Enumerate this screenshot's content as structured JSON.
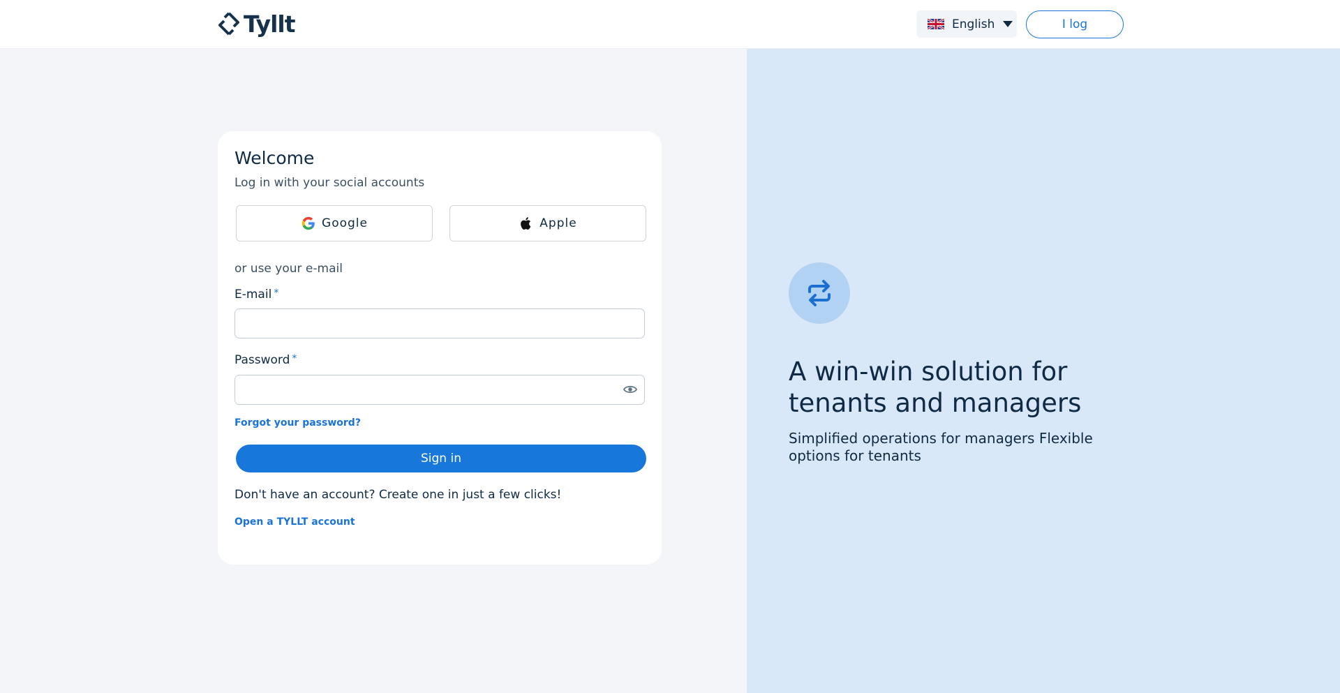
{
  "header": {
    "logo_text": "Tyllt",
    "language": {
      "selected": "English",
      "flag": "uk-flag-icon"
    },
    "login_label": "I log"
  },
  "login": {
    "title": "Welcome",
    "subtitle": "Log in with your social accounts",
    "google_label": "Google",
    "apple_label": "Apple",
    "or_email": "or use your e-mail",
    "email_label": "E-mail",
    "email_value": "",
    "password_label": "Password",
    "password_value": "",
    "required_mark": "*",
    "forgot_label": "Forgot your password?",
    "signin_label": "Sign in",
    "no_account_text": "Don't have an account? Create one in just a few clicks!",
    "open_account_label": "Open a TYLLT account"
  },
  "promo": {
    "icon": "arrows-exchange-icon",
    "title": "A win-win solution for tenants and managers",
    "text": "Simplified operations for managers Flexible options for tenants"
  },
  "colors": {
    "accent": "#1877db",
    "text_dark": "#0f2a44",
    "left_bg": "#f3f5f8",
    "right_bg": "#d9e8f8",
    "icon_circle": "#b2d2f3"
  }
}
